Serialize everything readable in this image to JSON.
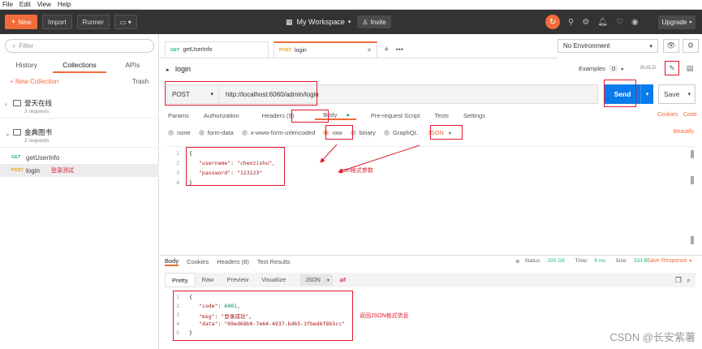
{
  "menu": [
    "File",
    "Edit",
    "View",
    "Help"
  ],
  "topbar": {
    "new_label": "New",
    "import_label": "Import",
    "runner_label": "Runner",
    "workspace": "My Workspace",
    "invite_label": "Invite",
    "upgrade_label": "Upgrade"
  },
  "sidebar": {
    "filter_placeholder": "Filter",
    "tabs": [
      "History",
      "Collections",
      "APIs"
    ],
    "new_collection": "+ New Collection",
    "trash": "Trash",
    "collections": [
      {
        "name": "誉天在线",
        "count": "3 requests"
      },
      {
        "name": "金典图书",
        "count": "2 requests"
      }
    ],
    "requests": [
      {
        "method": "GET",
        "name": "getUserInfo",
        "note": ""
      },
      {
        "method": "POST",
        "name": "login",
        "note": "登录测试"
      }
    ]
  },
  "tabs": [
    {
      "method": "GET",
      "name": "getUserInfo"
    },
    {
      "method": "POST",
      "name": "login"
    }
  ],
  "environment": "No Environment",
  "request": {
    "title": "login",
    "examples_label": "Examples",
    "examples_count": "0",
    "build_label": "BUILD",
    "method": "POST",
    "url": "http://localhost:6060/admin/login",
    "send_label": "Send",
    "save_label": "Save"
  },
  "req_tabs": [
    "Params",
    "Authorization",
    "Headers (9)",
    "Body",
    "Pre-request Script",
    "Tests",
    "Settings"
  ],
  "req_links": {
    "cookies": "Cookies",
    "code": "Code"
  },
  "body_types": [
    "none",
    "form-data",
    "x-www-form-urlencoded",
    "raw",
    "binary",
    "GraphQL"
  ],
  "body_format": "JSON",
  "beautify": "Beautify",
  "request_body": {
    "line1": "{",
    "key1": "\"username\"",
    "val1": "\"chenzishu\",",
    "key2": "\"password\"",
    "val2": "\"123123\"",
    "line4": "}"
  },
  "annotation_request": "json格式参数",
  "response": {
    "tabs": [
      "Body",
      "Cookies",
      "Headers (8)",
      "Test Results"
    ],
    "status_label": "Status:",
    "status_value": "200 OK",
    "time_label": "Time:",
    "time_value": "9 ms",
    "size_label": "Size:",
    "size_value": "333 B",
    "save_response": "Save Response",
    "views": [
      "Pretty",
      "Raw",
      "Preview",
      "Visualize"
    ],
    "format": "JSON",
    "line1": "{",
    "key_code": "\"code\"",
    "val_code": "6001",
    "key_msg": "\"msg\"",
    "val_msg": "\"登录成功\"",
    "key_data": "\"data\"",
    "val_data": "\"69ed68b0-7e64-4937-bd65-3fbed6f8b5cc\"",
    "line5": "}"
  },
  "annotation_response": "返回JSON格式信息",
  "watermark": "CSDN @长安紫薯"
}
